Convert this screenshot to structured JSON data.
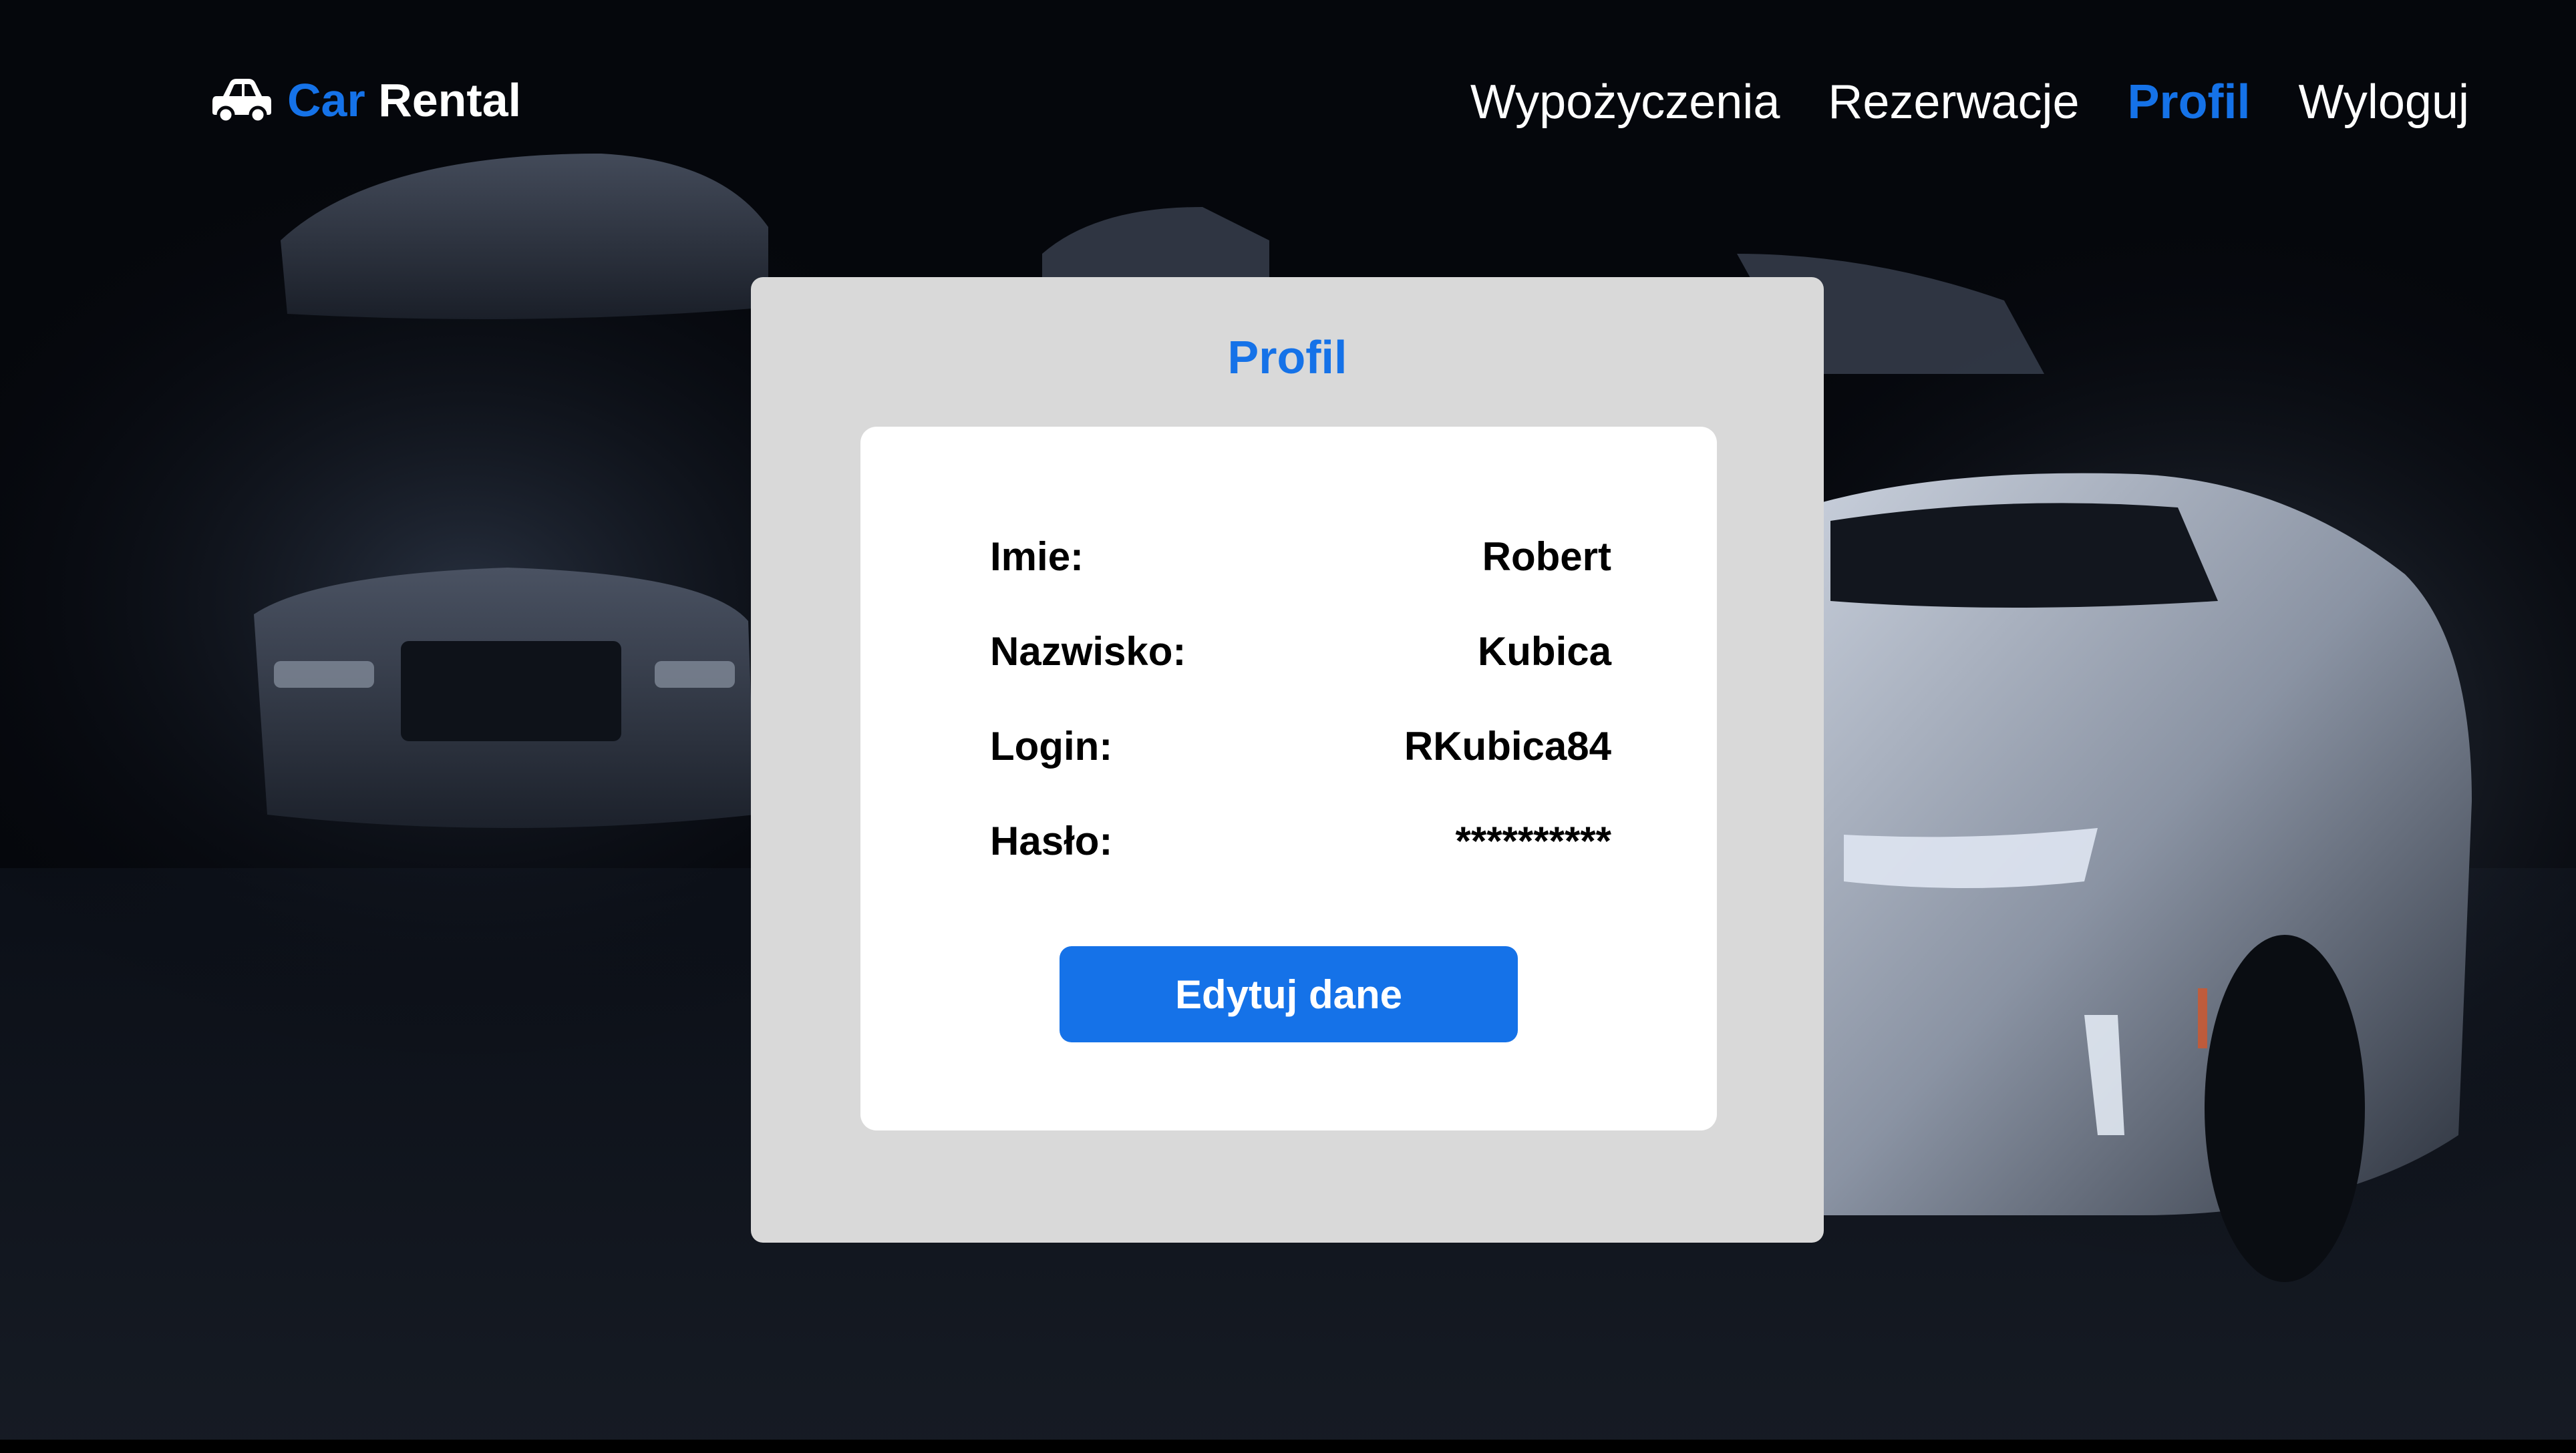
{
  "brand": {
    "word1": "Car",
    "word2": "Rental",
    "icon": "car-icon",
    "accent_color": "#1572e8"
  },
  "nav": {
    "items": [
      {
        "label": "Wypożyczenia"
      },
      {
        "label": "Rezerwacje"
      },
      {
        "label": "Profil",
        "active": true
      },
      {
        "label": "Wyloguj"
      }
    ]
  },
  "profile": {
    "title": "Profil",
    "fields": [
      {
        "label": "Imie:",
        "value": "Robert"
      },
      {
        "label": "Nazwisko:",
        "value": "Kubica"
      },
      {
        "label": "Login:",
        "value": "RKubica84"
      },
      {
        "label": "Hasło:",
        "value": "**********"
      }
    ],
    "edit_label": "Edytuj dane"
  },
  "colors": {
    "card_background": "#d9d9d9",
    "panel_background": "#ffffff",
    "button": "#1572e8"
  }
}
